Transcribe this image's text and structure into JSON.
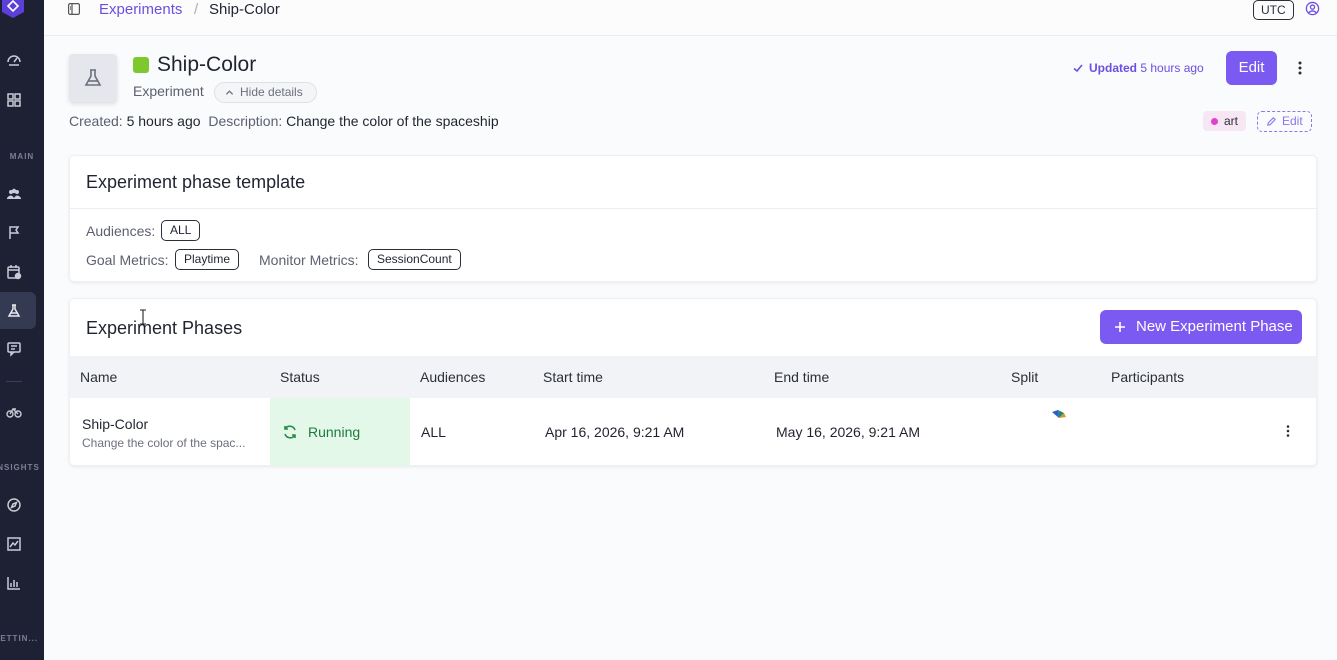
{
  "sidebar": {
    "sections": [
      "MAIN",
      "INSIGHTS",
      "SETTIN..."
    ],
    "icons": [
      "dashboard-icon",
      "grid-icon",
      "users-icon",
      "flag-icon",
      "calendar-icon",
      "flask-icon",
      "chat-icon",
      "bike-icon",
      "compass-icon",
      "trend-icon",
      "bar-chart-icon"
    ]
  },
  "breadcrumb": {
    "parent": "Experiments",
    "separator": "/",
    "current": "Ship-Color"
  },
  "topbar": {
    "timezone": "UTC"
  },
  "header": {
    "title": "Ship-Color",
    "color": "#7dc92d",
    "subtype": "Experiment",
    "hide_details": "Hide details",
    "created_label": "Created:",
    "created_value": "5 hours ago",
    "description_label": "Description:",
    "description_value": "Change the color of the spaceship",
    "updated_label": "Updated",
    "updated_value": "5 hours ago",
    "edit_label": "Edit",
    "tag": "art",
    "tag_edit_label": "Edit"
  },
  "template": {
    "title": "Experiment phase template",
    "audiences_label": "Audiences:",
    "audiences_value": "ALL",
    "goal_label": "Goal Metrics:",
    "goal_value": "Playtime",
    "monitor_label": "Monitor Metrics:",
    "monitor_value": "SessionCount"
  },
  "phases": {
    "title": "Experiment Phases",
    "new_button": "New Experiment Phase",
    "columns": [
      "Name",
      "Status",
      "Audiences",
      "Start time",
      "End time",
      "Split",
      "Participants"
    ],
    "rows": [
      {
        "name": "Ship-Color",
        "description": "Change the color of the spac...",
        "status": "Running",
        "audiences": "ALL",
        "start": "Apr 16, 2026, 9:21 AM",
        "end": "May 16, 2026, 9:21 AM",
        "participants": ""
      }
    ]
  },
  "colors": {
    "accent": "#7a5af0",
    "link": "#6d4fe0",
    "running_bg": "#e3f8e8",
    "sidebar": "#1d2133"
  }
}
